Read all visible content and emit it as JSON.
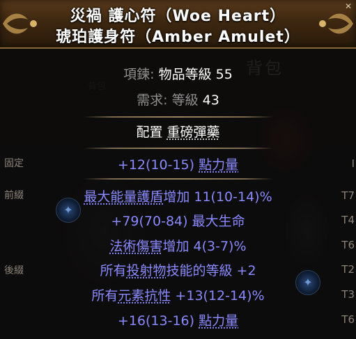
{
  "header": {
    "line1": "災禍 護心符（Woe Heart）",
    "line2": "琥珀護身符（Amber Amulet）"
  },
  "background": {
    "title": "背包",
    "tag": "背包"
  },
  "properties": {
    "type_name": "項鍊:",
    "ilvl_name": "物品等級",
    "ilvl_value": "55",
    "req_name": "需求:",
    "req_level_name": "等級",
    "req_level_value": "43"
  },
  "enchant": {
    "label": "配置",
    "value": "重磅彈藥"
  },
  "implicit": {
    "label": "固定",
    "tier": "I",
    "pre": "+12(10-15) ",
    "u": "點力量",
    "post": ""
  },
  "sections": {
    "prefix_label": "前綴",
    "suffix_label": "後綴"
  },
  "mods": [
    {
      "pre": "",
      "u": "最大能量護盾",
      "post": "增加 11(10-14)%",
      "tier": "T7"
    },
    {
      "pre": "+79(70-84) 最大生命",
      "u": "",
      "post": "",
      "tier": "T4"
    },
    {
      "pre": "",
      "u": "法術傷害",
      "post": "增加 4(3-7)%",
      "tier": "T6"
    },
    {
      "pre": "所有",
      "u": "投射物",
      "post": "技能的等級 +2",
      "tier": "T2"
    },
    {
      "pre": "所有",
      "u": "元素抗性",
      "post": " +13(12-14)%",
      "tier": "T3"
    },
    {
      "pre": "+16(13-16) ",
      "u": "點力量",
      "post": "",
      "tier": "T6"
    }
  ],
  "colors": {
    "mod": "#8a8aff",
    "header_bg": "#3d2710",
    "property_name": "#8f8f8f",
    "value": "#ffffff"
  }
}
